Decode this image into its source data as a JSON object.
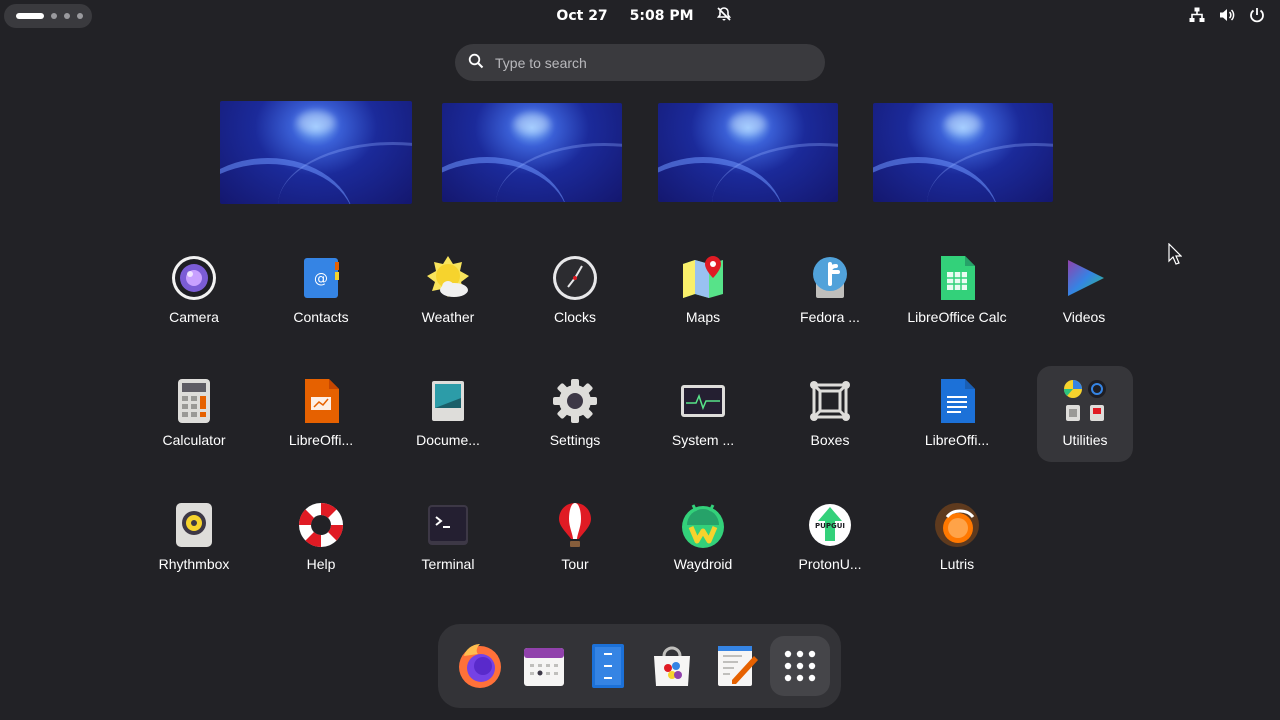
{
  "topbar": {
    "date": "Oct 27",
    "time": "5:08 PM"
  },
  "search": {
    "placeholder": "Type to search"
  },
  "apps": {
    "camera": "Camera",
    "contacts": "Contacts",
    "weather": "Weather",
    "clocks": "Clocks",
    "maps": "Maps",
    "fedora": "Fedora ...",
    "libreoffice_calc": "LibreOffice Calc",
    "videos": "Videos",
    "calculator": "Calculator",
    "libreoffice_impress": "LibreOffi...",
    "document_viewer": "Docume...",
    "settings": "Settings",
    "system_monitor": "System ...",
    "boxes": "Boxes",
    "libreoffice_writer": "LibreOffi...",
    "utilities": "Utilities",
    "rhythmbox": "Rhythmbox",
    "help": "Help",
    "terminal": "Terminal",
    "tour": "Tour",
    "waydroid": "Waydroid",
    "protonup": "ProtonU...",
    "lutris": "Lutris"
  },
  "colors": {
    "background": "#222226",
    "accent": "#3584e4"
  }
}
